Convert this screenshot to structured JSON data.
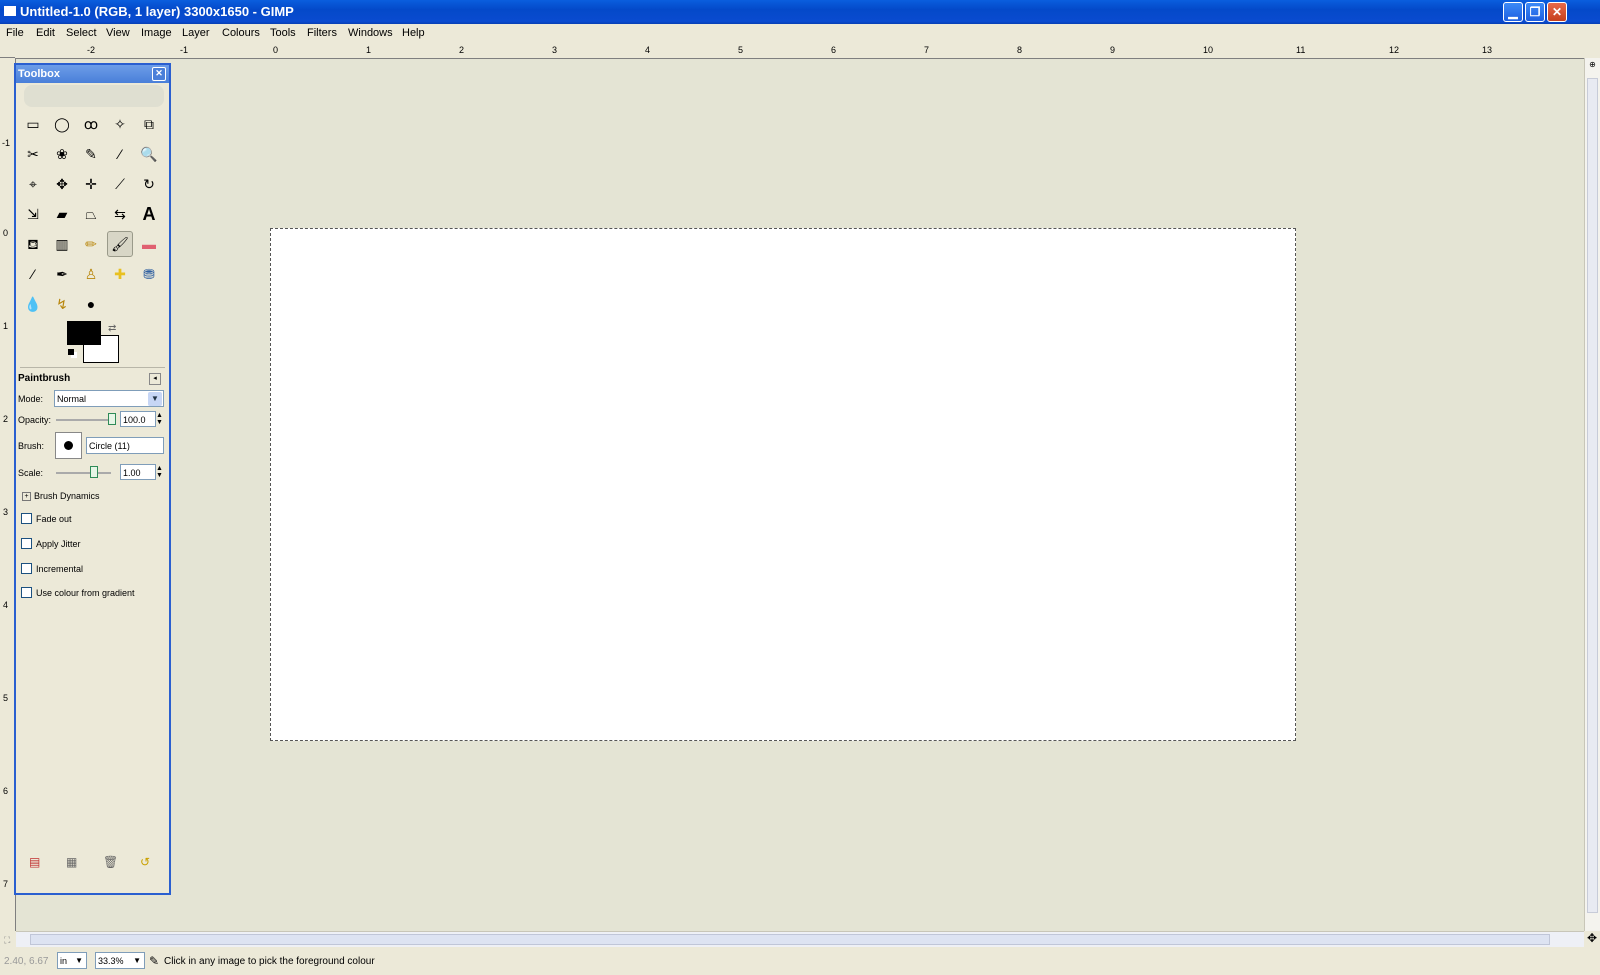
{
  "window": {
    "title": "Untitled-1.0 (RGB, 1 layer) 3300x1650 - GIMP",
    "min_glyph": "▁",
    "max_glyph": "❐",
    "close_glyph": "✕"
  },
  "menu": [
    "File",
    "Edit",
    "Select",
    "View",
    "Image",
    "Layer",
    "Colours",
    "Tools",
    "Filters",
    "Windows",
    "Help"
  ],
  "rulers": {
    "h_labels": [
      "-2",
      "-1",
      "0",
      "1",
      "2",
      "3",
      "4",
      "5",
      "6",
      "7",
      "8",
      "9",
      "10",
      "11",
      "12",
      "13"
    ],
    "v_labels": [
      "-1",
      "0",
      "1",
      "2",
      "3",
      "4",
      "5",
      "6",
      "7"
    ]
  },
  "toolbox": {
    "title": "Toolbox",
    "tools": [
      "rect-select",
      "ellipse-select",
      "free-select",
      "fuzzy-select",
      "select-by-color",
      "scissors",
      "foreground-select",
      "paths",
      "color-picker",
      "zoom",
      "measure",
      "move",
      "align",
      "crop",
      "rotate",
      "scale",
      "shear",
      "perspective",
      "flip",
      "text",
      "bucket-fill",
      "blend",
      "pencil",
      "paintbrush",
      "eraser",
      "airbrush",
      "ink",
      "clone",
      "heal",
      "perspective-clone",
      "blur-sharpen",
      "smudge",
      "dodge-burn"
    ],
    "tool_glyphs": [
      "▭",
      "◯",
      "ꝏ",
      "✧",
      "⧉",
      "✂",
      "❀",
      "✎",
      "⁄",
      "🔍",
      "⌖",
      "✥",
      "✛",
      "⟋",
      "↻",
      "⇲",
      "▰",
      "⏢",
      "⇆",
      "A",
      "⛾",
      "▥",
      "✏",
      "🖌",
      "▬",
      "⁄",
      "✒",
      "♙",
      "✚",
      "⛃",
      "💧",
      "↯",
      "●"
    ],
    "active_tool": "paintbrush"
  },
  "tool_options": {
    "title": "Paintbrush",
    "mode_label": "Mode:",
    "mode_value": "Normal",
    "opacity_label": "Opacity:",
    "opacity_value": "100.0",
    "brush_label": "Brush:",
    "brush_value": "Circle (11)",
    "scale_label": "Scale:",
    "scale_value": "1.00",
    "dynamics_label": "Brush Dynamics",
    "fade_out": "Fade out",
    "apply_jitter": "Apply Jitter",
    "incremental": "Incremental",
    "use_gradient": "Use colour from gradient"
  },
  "status": {
    "coords": "2.40, 6.67",
    "unit": "in",
    "zoom": "33.3%",
    "message": "Click in any image to pick the foreground colour"
  },
  "colors": {
    "foreground": "#000000",
    "background": "#ffffff",
    "accent": "#0a5ede"
  }
}
